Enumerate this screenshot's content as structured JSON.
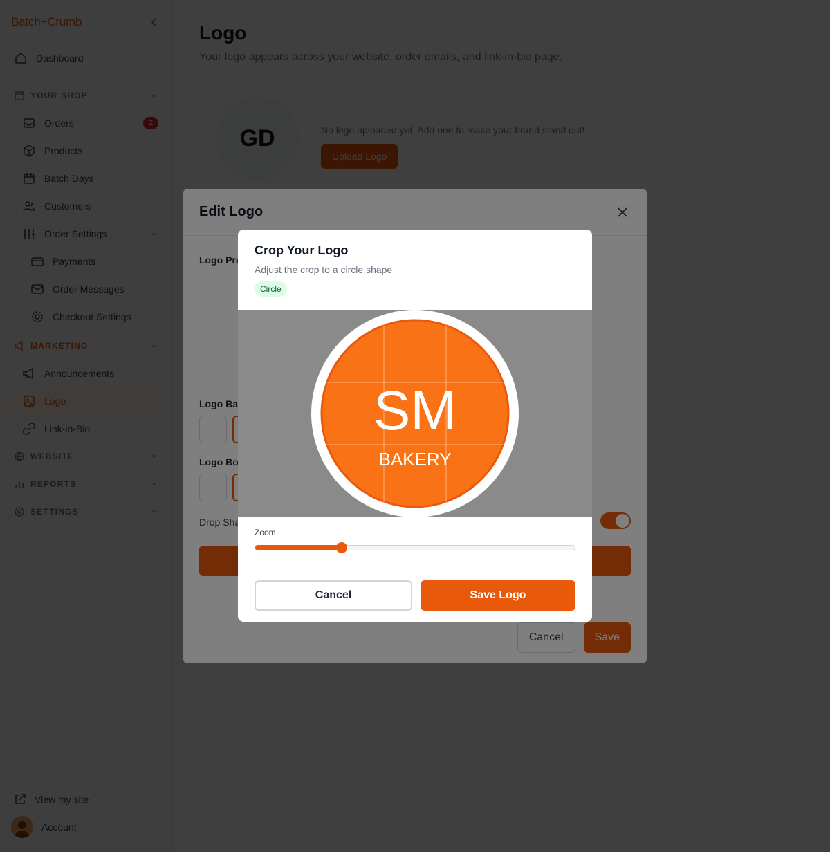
{
  "sidebar": {
    "brand": "Batch+Crumb",
    "dashboard": "Dashboard",
    "section_shop": "YOUR SHOP",
    "orders": "Orders",
    "orders_badge": "2",
    "products": "Products",
    "batch_days": "Batch Days",
    "customers": "Customers",
    "order_settings": "Order Settings",
    "payments": "Payments",
    "order_messages": "Order Messages",
    "checkout_settings": "Checkout Settings",
    "section_marketing": "MARKETING",
    "announcements": "Announcements",
    "logo": "Logo",
    "link_in_bio": "Link-in-Bio",
    "section_website": "WEBSITE",
    "section_reports": "REPORTS",
    "section_settings": "SETTINGS",
    "view_site": "View my site",
    "account": "Account"
  },
  "page": {
    "title": "Logo",
    "subtitle": "Your logo appears across your website, order emails, and link-in-bio page.",
    "placeholder_initials": "GD",
    "no_logo_text": "No logo uploaded yet. Add one to make your brand stand out!",
    "upload_button": "Upload Logo"
  },
  "edit_modal": {
    "title": "Edit Logo",
    "preview_label": "Logo Pre",
    "background_label": "Logo Bac",
    "border_label": "Logo Bor",
    "shadow_label": "Drop Sha",
    "shadow_enabled": true,
    "cancel": "Cancel",
    "save": "Save"
  },
  "crop_modal": {
    "title": "Crop Your Logo",
    "subtitle": "Adjust the crop to a circle shape",
    "shape_pill": "Circle",
    "logo_main_text": "SM",
    "logo_sub_text": "BAKERY",
    "logo_color": "#f97316",
    "zoom_label": "Zoom",
    "zoom_fraction": 0.27,
    "cancel": "Cancel",
    "save": "Save Logo"
  },
  "colors": {
    "accent": "#e8590c",
    "badge": "#dc2626"
  }
}
